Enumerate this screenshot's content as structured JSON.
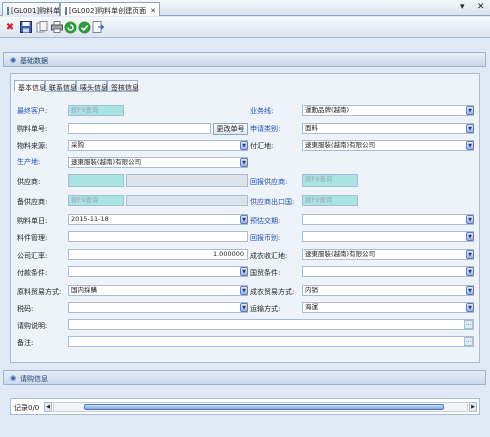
{
  "tabs": [
    {
      "label": "[GL001]购料单"
    },
    {
      "label": "[GL002]购料单创建页面"
    }
  ],
  "toolbar": {
    "items": [
      "close",
      "save",
      "copy",
      "print",
      "refresh",
      "approve",
      "exit"
    ]
  },
  "section_basic": {
    "title": "基础数据"
  },
  "form_tabs": [
    {
      "label": "基本信息"
    },
    {
      "label": "联系信息"
    },
    {
      "label": "唛头信息"
    },
    {
      "label": "签核信息"
    }
  ],
  "placeholder": "按F9查询",
  "change_button": "更改单号",
  "left": {
    "final_customer": "最终客户:",
    "order_no": "购料单号:",
    "material_source": "物料来源:",
    "material_source_value": "采购",
    "production_site": "生产地:",
    "production_site_value": "速東服裝(越南)有限公司",
    "supplier": "供应商:",
    "backup_supplier": "备供应商:",
    "order_date": "购料单日:",
    "order_date_value": "2015-11-18",
    "material_mgmt": "料件管理:",
    "company_rate": "公司汇率:",
    "company_rate_value": "1.000000",
    "payment_terms": "付款条件:",
    "raw_trade_mode": "原料贸易方式:",
    "raw_trade_mode_value": "国内採購",
    "tax_code": "税码:",
    "purchase_note": "请购说明:",
    "remark": "备注:"
  },
  "right": {
    "business_line": "业务线:",
    "business_line_value": "運動品牌(越南)",
    "request_type": "申请类别:",
    "request_type_value": "面料",
    "payment_place": "付汇地:",
    "payment_place_value": "速東服裝(越南)有限公司",
    "report_supplier": "回报供应商:",
    "supplier_export": "供应商出口国:",
    "arrival_port": "预估交期:",
    "report_currency": "回报币别:",
    "finished_place": "成衣收汇地:",
    "finished_place_value": "速東服裝(越南)有限公司",
    "intl_terms": "国贸条件:",
    "finished_trade_mode": "成衣贸易方式:",
    "finished_trade_mode_value": "内销",
    "transport": "运输方式:",
    "transport_value": "海運"
  },
  "section_request": {
    "title": "请购信息"
  },
  "records": "记录0/0"
}
